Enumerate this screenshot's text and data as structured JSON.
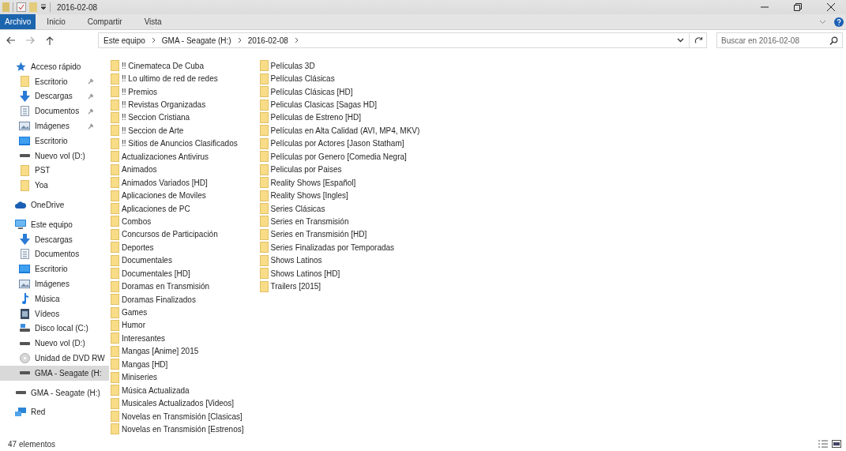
{
  "window": {
    "title": "2016-02-08"
  },
  "ribbon_tabs": [
    {
      "label": "Archivo",
      "selected": true
    },
    {
      "label": "Inicio",
      "selected": false
    },
    {
      "label": "Compartir",
      "selected": false
    },
    {
      "label": "Vista",
      "selected": false
    }
  ],
  "address_bar": {
    "breadcrumbs": [
      "Este equipo",
      "GMA - Seagate  (H:)",
      "2016-02-08"
    ]
  },
  "search": {
    "placeholder": "Buscar en 2016-02-08"
  },
  "sidebar": {
    "groups": [
      {
        "label": "Acceso rápido",
        "kind": "star",
        "selected": false,
        "children": [
          {
            "label": "Escritorio",
            "kind": "folder",
            "pinned": true,
            "selected": false
          },
          {
            "label": "Descargas",
            "kind": "download",
            "pinned": true,
            "selected": false
          },
          {
            "label": "Documentos",
            "kind": "document",
            "pinned": true,
            "selected": false
          },
          {
            "label": "Imágenes",
            "kind": "image",
            "pinned": true,
            "selected": false
          },
          {
            "label": "Escritorio",
            "kind": "desktop",
            "pinned": false,
            "selected": false
          },
          {
            "label": "Nuevo vol (D:)",
            "kind": "drive",
            "pinned": false,
            "selected": false
          },
          {
            "label": "PST",
            "kind": "folder",
            "pinned": false,
            "selected": false
          },
          {
            "label": "Yoa",
            "kind": "folder",
            "pinned": false,
            "selected": false
          }
        ]
      },
      {
        "label": "OneDrive",
        "kind": "cloud",
        "selected": false
      },
      {
        "label": "Este equipo",
        "kind": "computer",
        "selected": false,
        "children": [
          {
            "label": "Descargas",
            "kind": "download",
            "pinned": false,
            "selected": false
          },
          {
            "label": "Documentos",
            "kind": "document",
            "pinned": false,
            "selected": false
          },
          {
            "label": "Escritorio",
            "kind": "desktop",
            "pinned": false,
            "selected": false
          },
          {
            "label": "Imágenes",
            "kind": "image",
            "pinned": false,
            "selected": false
          },
          {
            "label": "Música",
            "kind": "music",
            "pinned": false,
            "selected": false
          },
          {
            "label": "Vídeos",
            "kind": "video",
            "pinned": false,
            "selected": false
          },
          {
            "label": "Disco local (C:)",
            "kind": "system-drive",
            "pinned": false,
            "selected": false
          },
          {
            "label": "Nuevo vol (D:)",
            "kind": "drive",
            "pinned": false,
            "selected": false
          },
          {
            "label": "Unidad de DVD RW",
            "kind": "dvd",
            "pinned": false,
            "selected": false
          },
          {
            "label": "GMA - Seagate  (H:",
            "kind": "drive",
            "pinned": false,
            "selected": true
          }
        ]
      },
      {
        "label": "GMA - Seagate  (H:)",
        "kind": "drive",
        "selected": false
      },
      {
        "label": "Red",
        "kind": "network",
        "selected": false
      }
    ]
  },
  "files": [
    "!! Cinemateca De Cuba",
    "!! Lo ultimo de red de redes",
    "!! Premios",
    "!! Revistas Organizadas",
    "!! Seccion Cristiana",
    "!! Seccion de Arte",
    "!! Sitios de Anuncios Clasificados",
    "Actualizaciones Antivirus",
    "Animados",
    "Animados Variados [HD]",
    "Aplicaciones de Moviles",
    "Aplicaciones de PC",
    "Combos",
    "Concursos de Participación",
    "Deportes",
    "Documentales",
    "Documentales [HD]",
    "Doramas en Transmisión",
    "Doramas Finalizados",
    "Games",
    "Humor",
    "Interesantes",
    "Mangas [Anime] 2015",
    "Mangas [HD]",
    "Miniseries",
    "Música Actualizada",
    "Musicales Actualizados [Videos]",
    "Novelas en Transmisión [Clasicas]",
    "Novelas en Transmisión [Estrenos]",
    "Películas 3D",
    "Películas Clásicas",
    "Películas Clásicas [HD]",
    "Peliculas Clasicas [Sagas HD]",
    "Películas de Estreno [HD]",
    "Películas en Alta Calidad (AVI, MP4, MKV)",
    "Películas por Actores [Jason Statham]",
    "Películas por Genero [Comedia Negra]",
    "Peliculas por Paises",
    "Reality Shows [Español]",
    "Reality Shows [Ingles]",
    "Series Clásicas",
    "Series en Transmisión",
    "Series en Transmisión [HD]",
    "Series Finalizadas por Temporadas",
    "Shows Latinos",
    "Shows Latinos [HD]",
    "Trailers [2015]"
  ],
  "status_bar": {
    "item_count": "47 elementos"
  }
}
